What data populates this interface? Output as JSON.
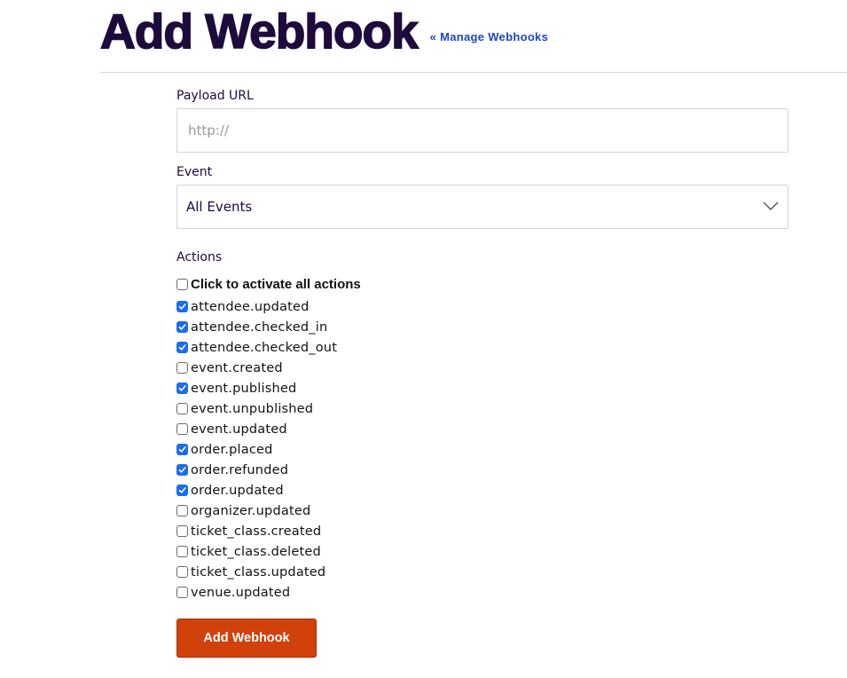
{
  "header": {
    "title": "Add Webhook",
    "manage_link": "« Manage Webhooks"
  },
  "form": {
    "payload_url": {
      "label": "Payload URL",
      "value": "",
      "placeholder": "http://"
    },
    "event": {
      "label": "Event",
      "selected": "All Events",
      "icon": "chevron-down-icon"
    },
    "actions": {
      "label": "Actions",
      "select_all": {
        "label": "Click to activate all actions",
        "checked": false
      },
      "items": [
        {
          "label": "attendee.updated",
          "checked": true
        },
        {
          "label": "attendee.checked_in",
          "checked": true
        },
        {
          "label": "attendee.checked_out",
          "checked": true
        },
        {
          "label": "event.created",
          "checked": false
        },
        {
          "label": "event.published",
          "checked": true
        },
        {
          "label": "event.unpublished",
          "checked": false
        },
        {
          "label": "event.updated",
          "checked": false
        },
        {
          "label": "order.placed",
          "checked": true
        },
        {
          "label": "order.refunded",
          "checked": true
        },
        {
          "label": "order.updated",
          "checked": true
        },
        {
          "label": "organizer.updated",
          "checked": false
        },
        {
          "label": "ticket_class.created",
          "checked": false
        },
        {
          "label": "ticket_class.deleted",
          "checked": false
        },
        {
          "label": "ticket_class.updated",
          "checked": false
        },
        {
          "label": "venue.updated",
          "checked": false
        }
      ]
    },
    "submit_label": "Add Webhook"
  },
  "colors": {
    "title": "#1e0a3c",
    "link": "#1c47c4",
    "checkbox_checked": "#1a6cf0",
    "submit_bg": "#d1410c"
  }
}
